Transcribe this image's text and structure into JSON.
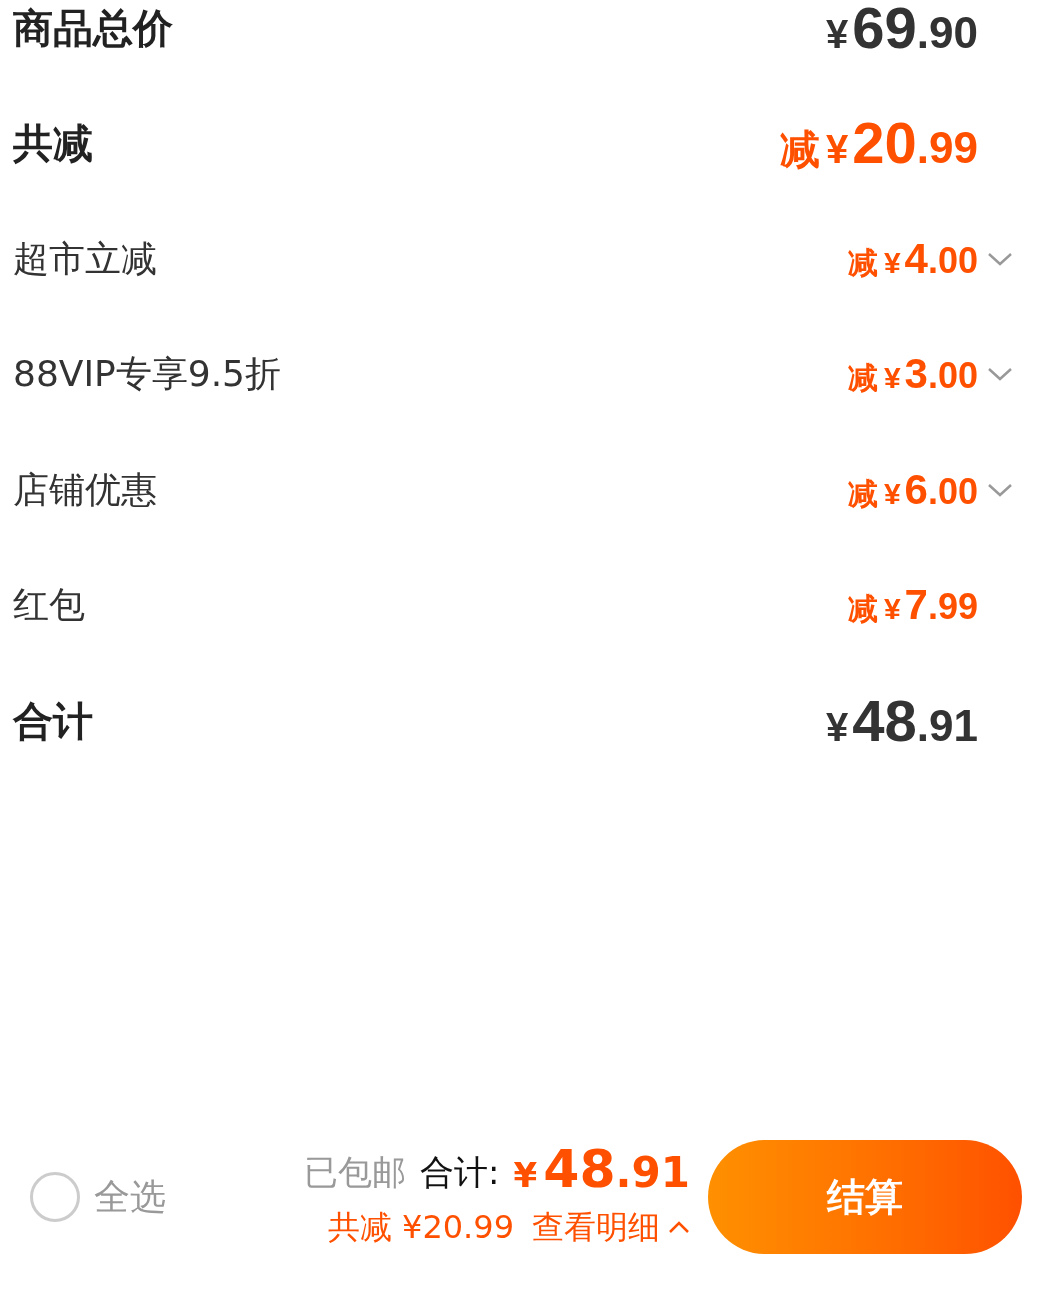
{
  "rows": [
    {
      "label": "商品总价",
      "kind": "total",
      "prefix": "",
      "currency": "¥",
      "whole": "69",
      "fraction": ".90",
      "expandable": false
    },
    {
      "label": "共减",
      "kind": "discount_total",
      "prefix": "减",
      "currency": "¥",
      "whole": "20",
      "fraction": ".99",
      "expandable": false
    },
    {
      "label": "超市立减",
      "kind": "discount",
      "prefix": "减",
      "currency": "¥",
      "whole": "4",
      "fraction": ".00",
      "expandable": true
    },
    {
      "label": "88VIP专享9.5折",
      "kind": "discount",
      "prefix": "减",
      "currency": "¥",
      "whole": "3",
      "fraction": ".00",
      "expandable": true
    },
    {
      "label": "店铺优惠",
      "kind": "discount",
      "prefix": "减",
      "currency": "¥",
      "whole": "6",
      "fraction": ".00",
      "expandable": true
    },
    {
      "label": "红包",
      "kind": "discount",
      "prefix": "减",
      "currency": "¥",
      "whole": "7",
      "fraction": ".99",
      "expandable": false
    },
    {
      "label": "合计",
      "kind": "total",
      "prefix": "",
      "currency": "¥",
      "whole": "48",
      "fraction": ".91",
      "expandable": false
    }
  ],
  "bottom_bar": {
    "select_all": {
      "label": "全选",
      "checked": false
    },
    "shipping": "已包邮",
    "total_label": "合计:",
    "total": {
      "currency": "¥",
      "whole": "48",
      "fraction": ".91"
    },
    "saved": "共减 ¥20.99",
    "details_link": "查看明细",
    "checkout_button": "结算"
  }
}
